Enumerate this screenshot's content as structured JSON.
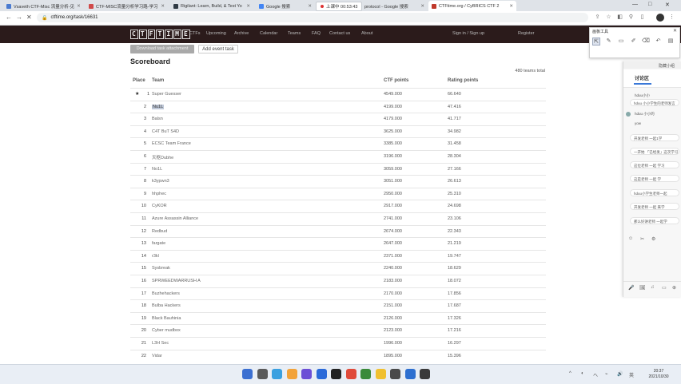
{
  "browser": {
    "tabs": [
      {
        "label": "Vsaveth CTF-Misc 流量分析-见",
        "fav": "#4a7bd0"
      },
      {
        "label": "CTF-MISC流量分析学习路-学习",
        "fav": "#d04a4a"
      },
      {
        "label": "Rigilant: Learn, Build, & Test Yo",
        "fav": "#2f3a44"
      },
      {
        "label": "Google 搜索",
        "fav": "#4285f4"
      },
      {
        "label": "protocol - Google 搜索",
        "fav": "#4285f4"
      },
      {
        "label": "CTFtime.org / CyBRICS CTF 2",
        "fav": "#c0392b"
      }
    ],
    "recording_label": "上课中 00:53:43",
    "url": "ctftime.org/task/16631",
    "win_controls": [
      "—",
      "□",
      "✕"
    ]
  },
  "site": {
    "logo_letters": [
      "C",
      "T",
      "F",
      "T",
      "I",
      "M",
      "E"
    ],
    "nav": [
      "CTFs",
      "Upcoming",
      "Archive",
      "Calendar",
      "Teams",
      "FAQ",
      "Contact us",
      "About"
    ],
    "nav_right": [
      "Sign in / Sign up",
      "Register"
    ],
    "download_button": "Download task attachment",
    "add_task_button": "Add event task",
    "title": "Scoreboard",
    "teams_total": "480 teams total",
    "headers": {
      "place": "Place",
      "team": "Team",
      "ctf_points": "CTF points",
      "rating_points": "Rating points"
    }
  },
  "scoreboard": [
    {
      "place": "1",
      "team": "Super Guesser",
      "pts": "4549.000",
      "rating": "66.640",
      "star": "★"
    },
    {
      "place": "2",
      "team": "Nu1L",
      "pts": "4199.000",
      "rating": "47.416",
      "sel": true
    },
    {
      "place": "3",
      "team": "Balsn",
      "pts": "4179.000",
      "rating": "41.717"
    },
    {
      "place": "4",
      "team": "C4T BuT S4D",
      "pts": "3625.000",
      "rating": "34.982"
    },
    {
      "place": "5",
      "team": "ECSC Team France",
      "pts": "3385.000",
      "rating": "31.458"
    },
    {
      "place": "6",
      "team": "天枢Dubhe",
      "pts": "3196.000",
      "rating": "28.304"
    },
    {
      "place": "7",
      "team": "No1L",
      "pts": "3059.000",
      "rating": "27.166"
    },
    {
      "place": "8",
      "team": "k3ypwn3",
      "pts": "3051.000",
      "rating": "26.613"
    },
    {
      "place": "9",
      "team": "hhphec",
      "pts": "2950.000",
      "rating": "25.310"
    },
    {
      "place": "10",
      "team": "CyKOR",
      "pts": "2917.000",
      "rating": "24.698"
    },
    {
      "place": "11",
      "team": "Azure Assassin Alliance",
      "pts": "2741.000",
      "rating": "23.106"
    },
    {
      "place": "12",
      "team": "Redbud",
      "pts": "2674.000",
      "rating": "22.343"
    },
    {
      "place": "13",
      "team": "fargate",
      "pts": "2647.000",
      "rating": "21.219"
    },
    {
      "place": "14",
      "team": "r3kl",
      "pts": "2371.000",
      "rating": "19.747"
    },
    {
      "place": "15",
      "team": "Sysbreak",
      "pts": "2240.000",
      "rating": "18.629"
    },
    {
      "place": "16",
      "team": "SPRWEEDWARRUSH A",
      "pts": "2183.000",
      "rating": "18.072"
    },
    {
      "place": "17",
      "team": "Buzhehackers",
      "pts": "2170.000",
      "rating": "17.856"
    },
    {
      "place": "18",
      "team": "Bulba Hackers",
      "pts": "2151.000",
      "rating": "17.687"
    },
    {
      "place": "19",
      "team": "Black Bauhinia",
      "pts": "2126.000",
      "rating": "17.326"
    },
    {
      "place": "20",
      "team": "Cyber mudbox",
      "pts": "2123.000",
      "rating": "17.216"
    },
    {
      "place": "21",
      "team": "L3H Sec",
      "pts": "1996.000",
      "rating": "16.297"
    },
    {
      "place": "22",
      "team": "Vidar",
      "pts": "1895.000",
      "rating": "15.396"
    }
  ],
  "toolpanel": {
    "title": "画板工具",
    "close": "✕",
    "tools": [
      "⇱",
      "✎",
      "▭",
      "✐",
      "⌫",
      "↶",
      "▤"
    ]
  },
  "chat": {
    "top": "隐藏小组",
    "tab": "讨论区",
    "messages": [
      {
        "text": "hduu小小",
        "style": "plain"
      },
      {
        "text": "hduu 小小学生的老师发言",
        "style": "bubble"
      },
      {
        "text": "hduu 小小的",
        "style": "plain"
      },
      {
        "text": "yow",
        "style": "plain"
      },
      {
        "text": "开发老师 一起1学",
        "style": "bubble"
      },
      {
        "text": "一开始 「已经发」这次学习",
        "style": "bubble"
      },
      {
        "text": "这位老师 一起 学习",
        "style": "bubble"
      },
      {
        "text": "这是老师 一起 学",
        "style": "bubble"
      },
      {
        "text": "hduu小学生老师一起",
        "style": "bubble"
      },
      {
        "text": "开发老师 一起 来学",
        "style": "bubble"
      },
      {
        "text": "那么好讲老师 一起学",
        "style": "bubble"
      }
    ],
    "actions": [
      "☺",
      "✂",
      "⚙"
    ],
    "bottom_icons": [
      "🎤",
      "🖼",
      "♫",
      "▭",
      "⊕"
    ]
  },
  "taskbar": {
    "time": "20:37",
    "date": "2021/10/30",
    "apps": [
      "#3b6fd1",
      "#5a5a5a",
      "#3aa0e0",
      "#f2a33a",
      "#6c4fd6",
      "#2b6ad9",
      "#222222",
      "#e04a3a",
      "#3a8a3a",
      "#f0c030",
      "#4a4a4a",
      "#2d6fd0",
      "#3a3a3a"
    ],
    "tray": [
      "^",
      "◐",
      "ヘ",
      "⌁",
      "🔊",
      "英"
    ]
  }
}
